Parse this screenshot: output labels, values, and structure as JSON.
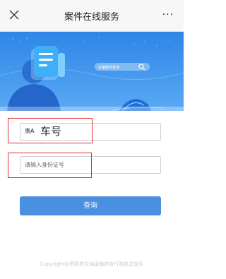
{
  "navbar": {
    "title": "案件在线服务",
    "more_label": "···",
    "close_icon": "close-icon"
  },
  "banner": {
    "search_placeholder": "车辆案件查询",
    "colors": {
      "sky": "#3d8fe8",
      "deep": "#2a6fd6"
    }
  },
  "form": {
    "plate_prefix": "贵A",
    "plate_value": "车号",
    "id_placeholder": "请输入身份证号",
    "id_value": ""
  },
  "query_button": {
    "label": "查询",
    "color": "#4a8fe0"
  },
  "footer": {
    "copyright": "Copyright@贵阳市交通运输综合行政执法支队"
  }
}
